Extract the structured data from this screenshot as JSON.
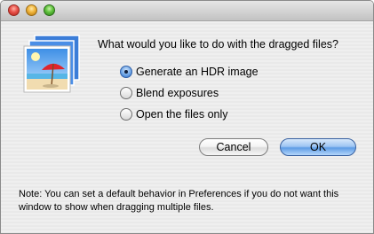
{
  "window": {
    "buttons": [
      {
        "name": "close",
        "color": "#e8514a"
      },
      {
        "name": "minimize",
        "color": "#f0b43a"
      },
      {
        "name": "zoom",
        "color": "#5fc23c"
      }
    ]
  },
  "dialog": {
    "icon": "stacked-photos-beach-umbrella-icon",
    "question": "What would you like to do with the dragged files?",
    "options": [
      {
        "label": "Generate an HDR image",
        "selected": true
      },
      {
        "label": "Blend exposures",
        "selected": false
      },
      {
        "label": "Open the files only",
        "selected": false
      }
    ],
    "cancel_label": "Cancel",
    "ok_label": "OK",
    "note": "Note: You can set a default behavior in Preferences if you do not want this window to show when dragging multiple files."
  }
}
